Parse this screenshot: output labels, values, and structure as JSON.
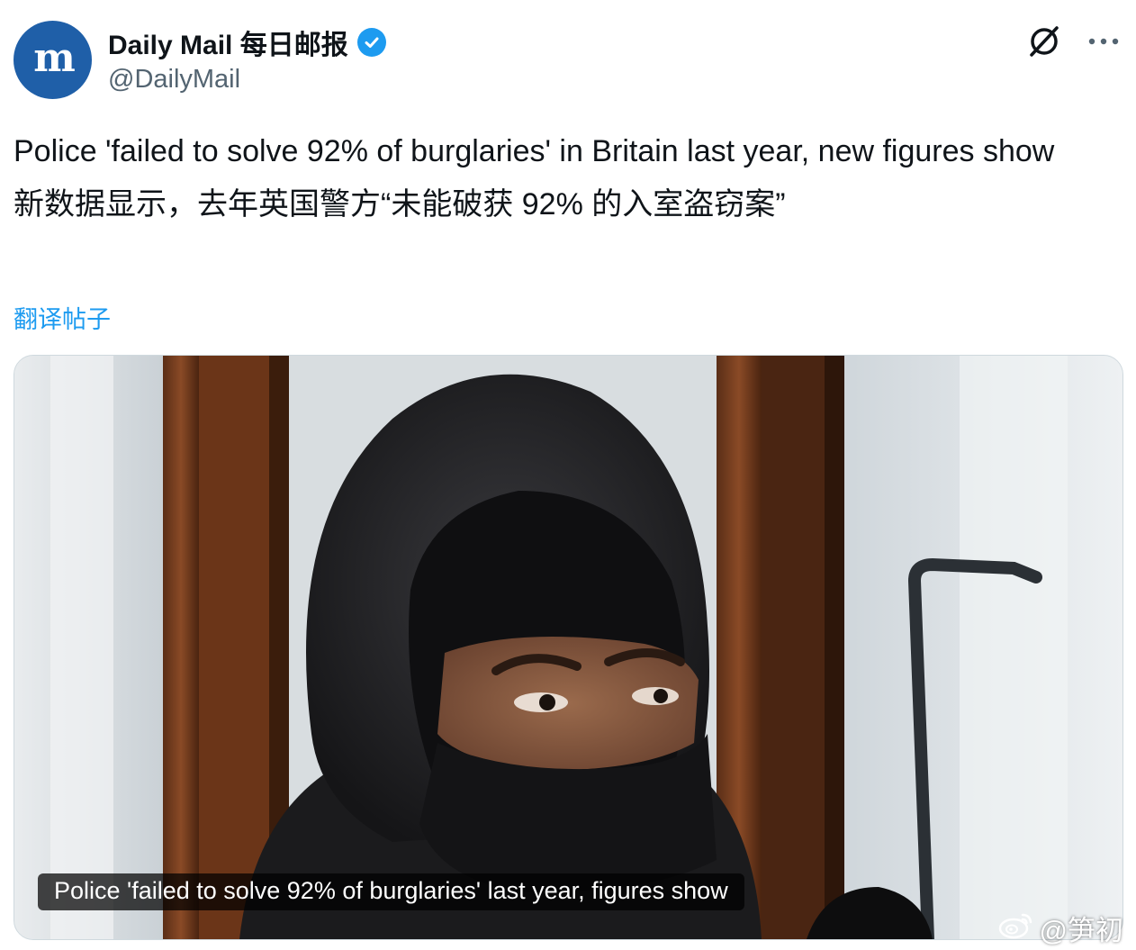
{
  "author": {
    "display_name": "Daily Mail 每日邮报",
    "handle": "@DailyMail",
    "avatar_icon": "daily-mail-logo",
    "verified_color": "#1d9bf0"
  },
  "tweet": {
    "text_en": "Police 'failed to solve 92% of burglaries' in Britain last year, new figures show",
    "text_zh": "新数据显示，去年英国警方“未能破获 92% 的入室盗窃案”",
    "translate_label": "翻译帖子"
  },
  "media": {
    "caption": "Police 'failed to solve 92% of burglaries' last year, figures show"
  },
  "watermark": {
    "text": "@笋初",
    "icon": "weibo-icon"
  },
  "top_actions": {
    "grok_icon": "grok-icon",
    "more_icon": "more-icon"
  },
  "colors": {
    "accent": "#1d9bf0",
    "text": "#0f1419",
    "secondary": "#536471",
    "avatar_bg": "#1f5fa8"
  }
}
